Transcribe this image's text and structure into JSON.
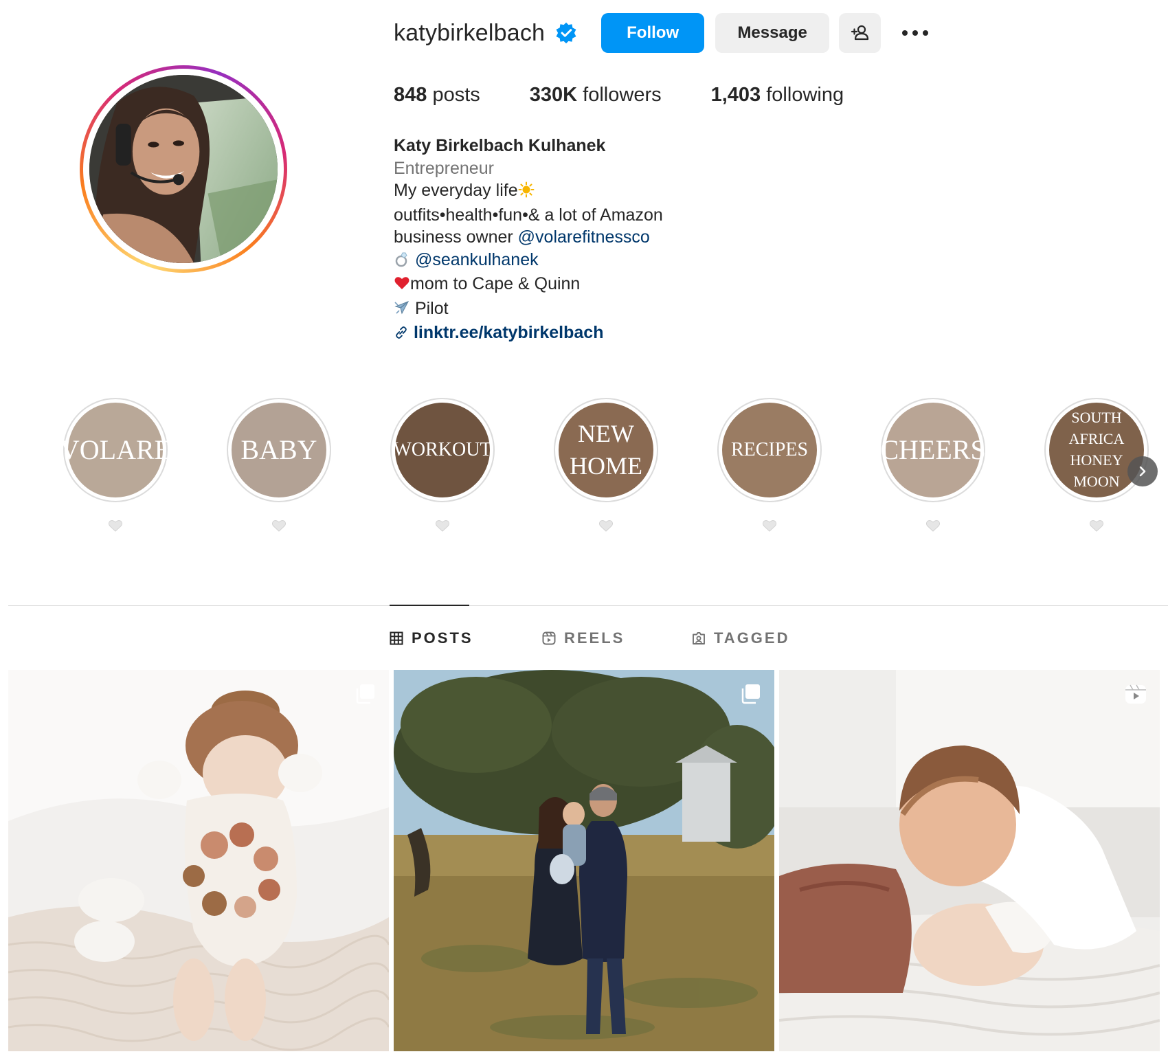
{
  "profile": {
    "username": "katybirkelbach",
    "verified": true,
    "follow_label": "Follow",
    "message_label": "Message",
    "avatar_alt": "profile photo"
  },
  "stats": {
    "posts_count": "848",
    "posts_label": "posts",
    "followers_count": "330K",
    "followers_label": "followers",
    "following_count": "1,403",
    "following_label": "following"
  },
  "bio": {
    "name": "Katy Birkelbach Kulhanek",
    "category": "Entrepreneur",
    "line1": "My everyday life",
    "line2": "outfits•health•fun•& a lot of Amazon",
    "line3_text": "business owner ",
    "line3_handle": "@volarefitnessco",
    "line4_handle": "@seankulhanek",
    "line5": "mom to Cape & Quinn",
    "line6": "Pilot",
    "link": "linktr.ee/katybirkelbach"
  },
  "highlights": [
    {
      "title_lines": [
        "VOLARE"
      ],
      "color": "#b9a898"
    },
    {
      "title_lines": [
        "BABY"
      ],
      "color": "#b3a295"
    },
    {
      "title_lines": [
        "WORKOUT"
      ],
      "color": "#6f5440"
    },
    {
      "title_lines": [
        "NEW",
        "HOME"
      ],
      "color": "#8a6a52"
    },
    {
      "title_lines": [
        "RECIPES"
      ],
      "color": "#9a7c63"
    },
    {
      "title_lines": [
        "CHEERS"
      ],
      "color": "#b9a595"
    },
    {
      "title_lines": [
        "SOUTH",
        "AFRICA",
        "HONEY",
        "MOON"
      ],
      "color": "#7f624b"
    }
  ],
  "tabs": {
    "posts": "POSTS",
    "reels": "REELS",
    "tagged": "TAGGED"
  },
  "colors": {
    "primary_button": "#0095f6",
    "secondary_button": "#efefef",
    "link": "#00376b",
    "muted": "#737373"
  },
  "posts": [
    {
      "type": "carousel",
      "icon": "carousel-icon"
    },
    {
      "type": "carousel",
      "icon": "carousel-icon"
    },
    {
      "type": "reel",
      "icon": "reel-icon"
    }
  ]
}
